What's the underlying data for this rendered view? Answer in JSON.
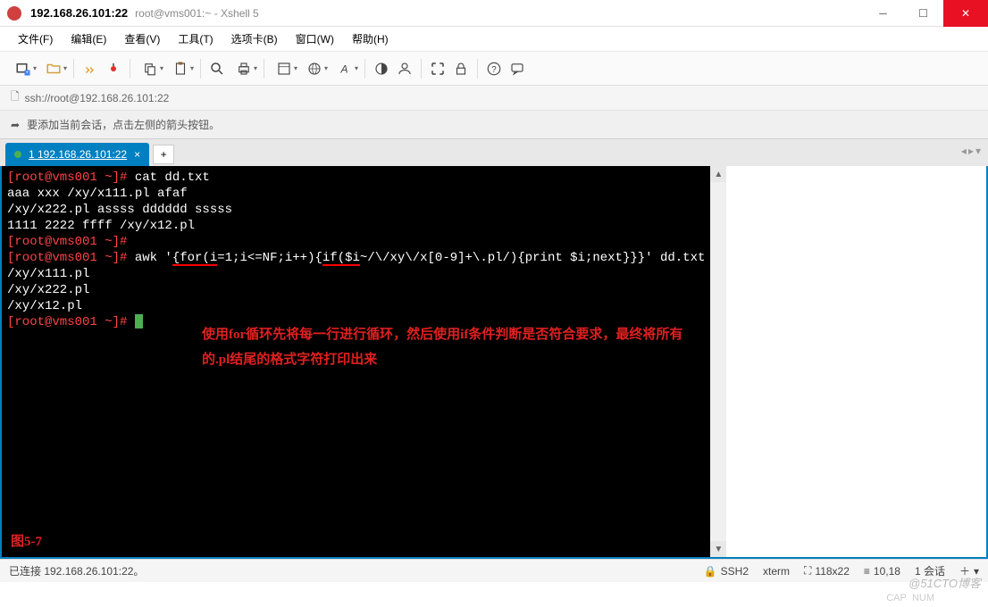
{
  "window": {
    "title_main": "192.168.26.101:22",
    "title_sub": "root@vms001:~ - Xshell 5"
  },
  "menu": {
    "file": "文件(F)",
    "edit": "编辑(E)",
    "view": "查看(V)",
    "tools": "工具(T)",
    "tabs": "选项卡(B)",
    "window": "窗口(W)",
    "help": "帮助(H)"
  },
  "addressbar": {
    "url": "ssh://root@192.168.26.101:22"
  },
  "hintbar": {
    "text": "要添加当前会话，点击左侧的箭头按钮。"
  },
  "tab": {
    "label": "1 192.168.26.101:22",
    "add": "+"
  },
  "terminal": {
    "lines": [
      {
        "prompt": "[root@vms001 ~]#",
        "cmd": " cat dd.txt"
      },
      {
        "text": "aaa xxx /xy/x111.pl afaf"
      },
      {
        "text": "/xy/x222.pl assss dddddd sssss"
      },
      {
        "text": "1111 2222 ffff /xy/x12.pl"
      },
      {
        "prompt": "[root@vms001 ~]#",
        "cmd": ""
      },
      {
        "prompt": "[root@vms001 ~]#",
        "cmd_pre": " awk '",
        "ul1": "{for(i",
        "mid1": "=1;i<=NF;i++){",
        "ul2": "if($i",
        "mid2": "~/\\/xy\\/x[0-9]+\\.pl/){print $i;next}}}' dd.txt"
      },
      {
        "text": "/xy/x111.pl"
      },
      {
        "text": "/xy/x222.pl"
      },
      {
        "text": "/xy/x12.pl"
      },
      {
        "prompt": "[root@vms001 ~]#",
        "cursor": true
      }
    ],
    "annotation_line1": "使用for循环先将每一行进行循环，然后使用if条件判断是否符合要求，最终将所有",
    "annotation_line2": "的.pl结尾的格式字符打印出来",
    "figure_label": "图5-7"
  },
  "statusbar": {
    "connected": "已连接 192.168.26.101:22。",
    "protocol": "SSH2",
    "term": "xterm",
    "size": "118x22",
    "pos": "10,18",
    "sessions": "1 会话",
    "caps": "CAP",
    "num": "NUM"
  },
  "watermark": "@51CTO博客",
  "icons": {
    "lock": "🔒",
    "arrow": "➦",
    "plus": "＋",
    "resize": "⛶"
  }
}
